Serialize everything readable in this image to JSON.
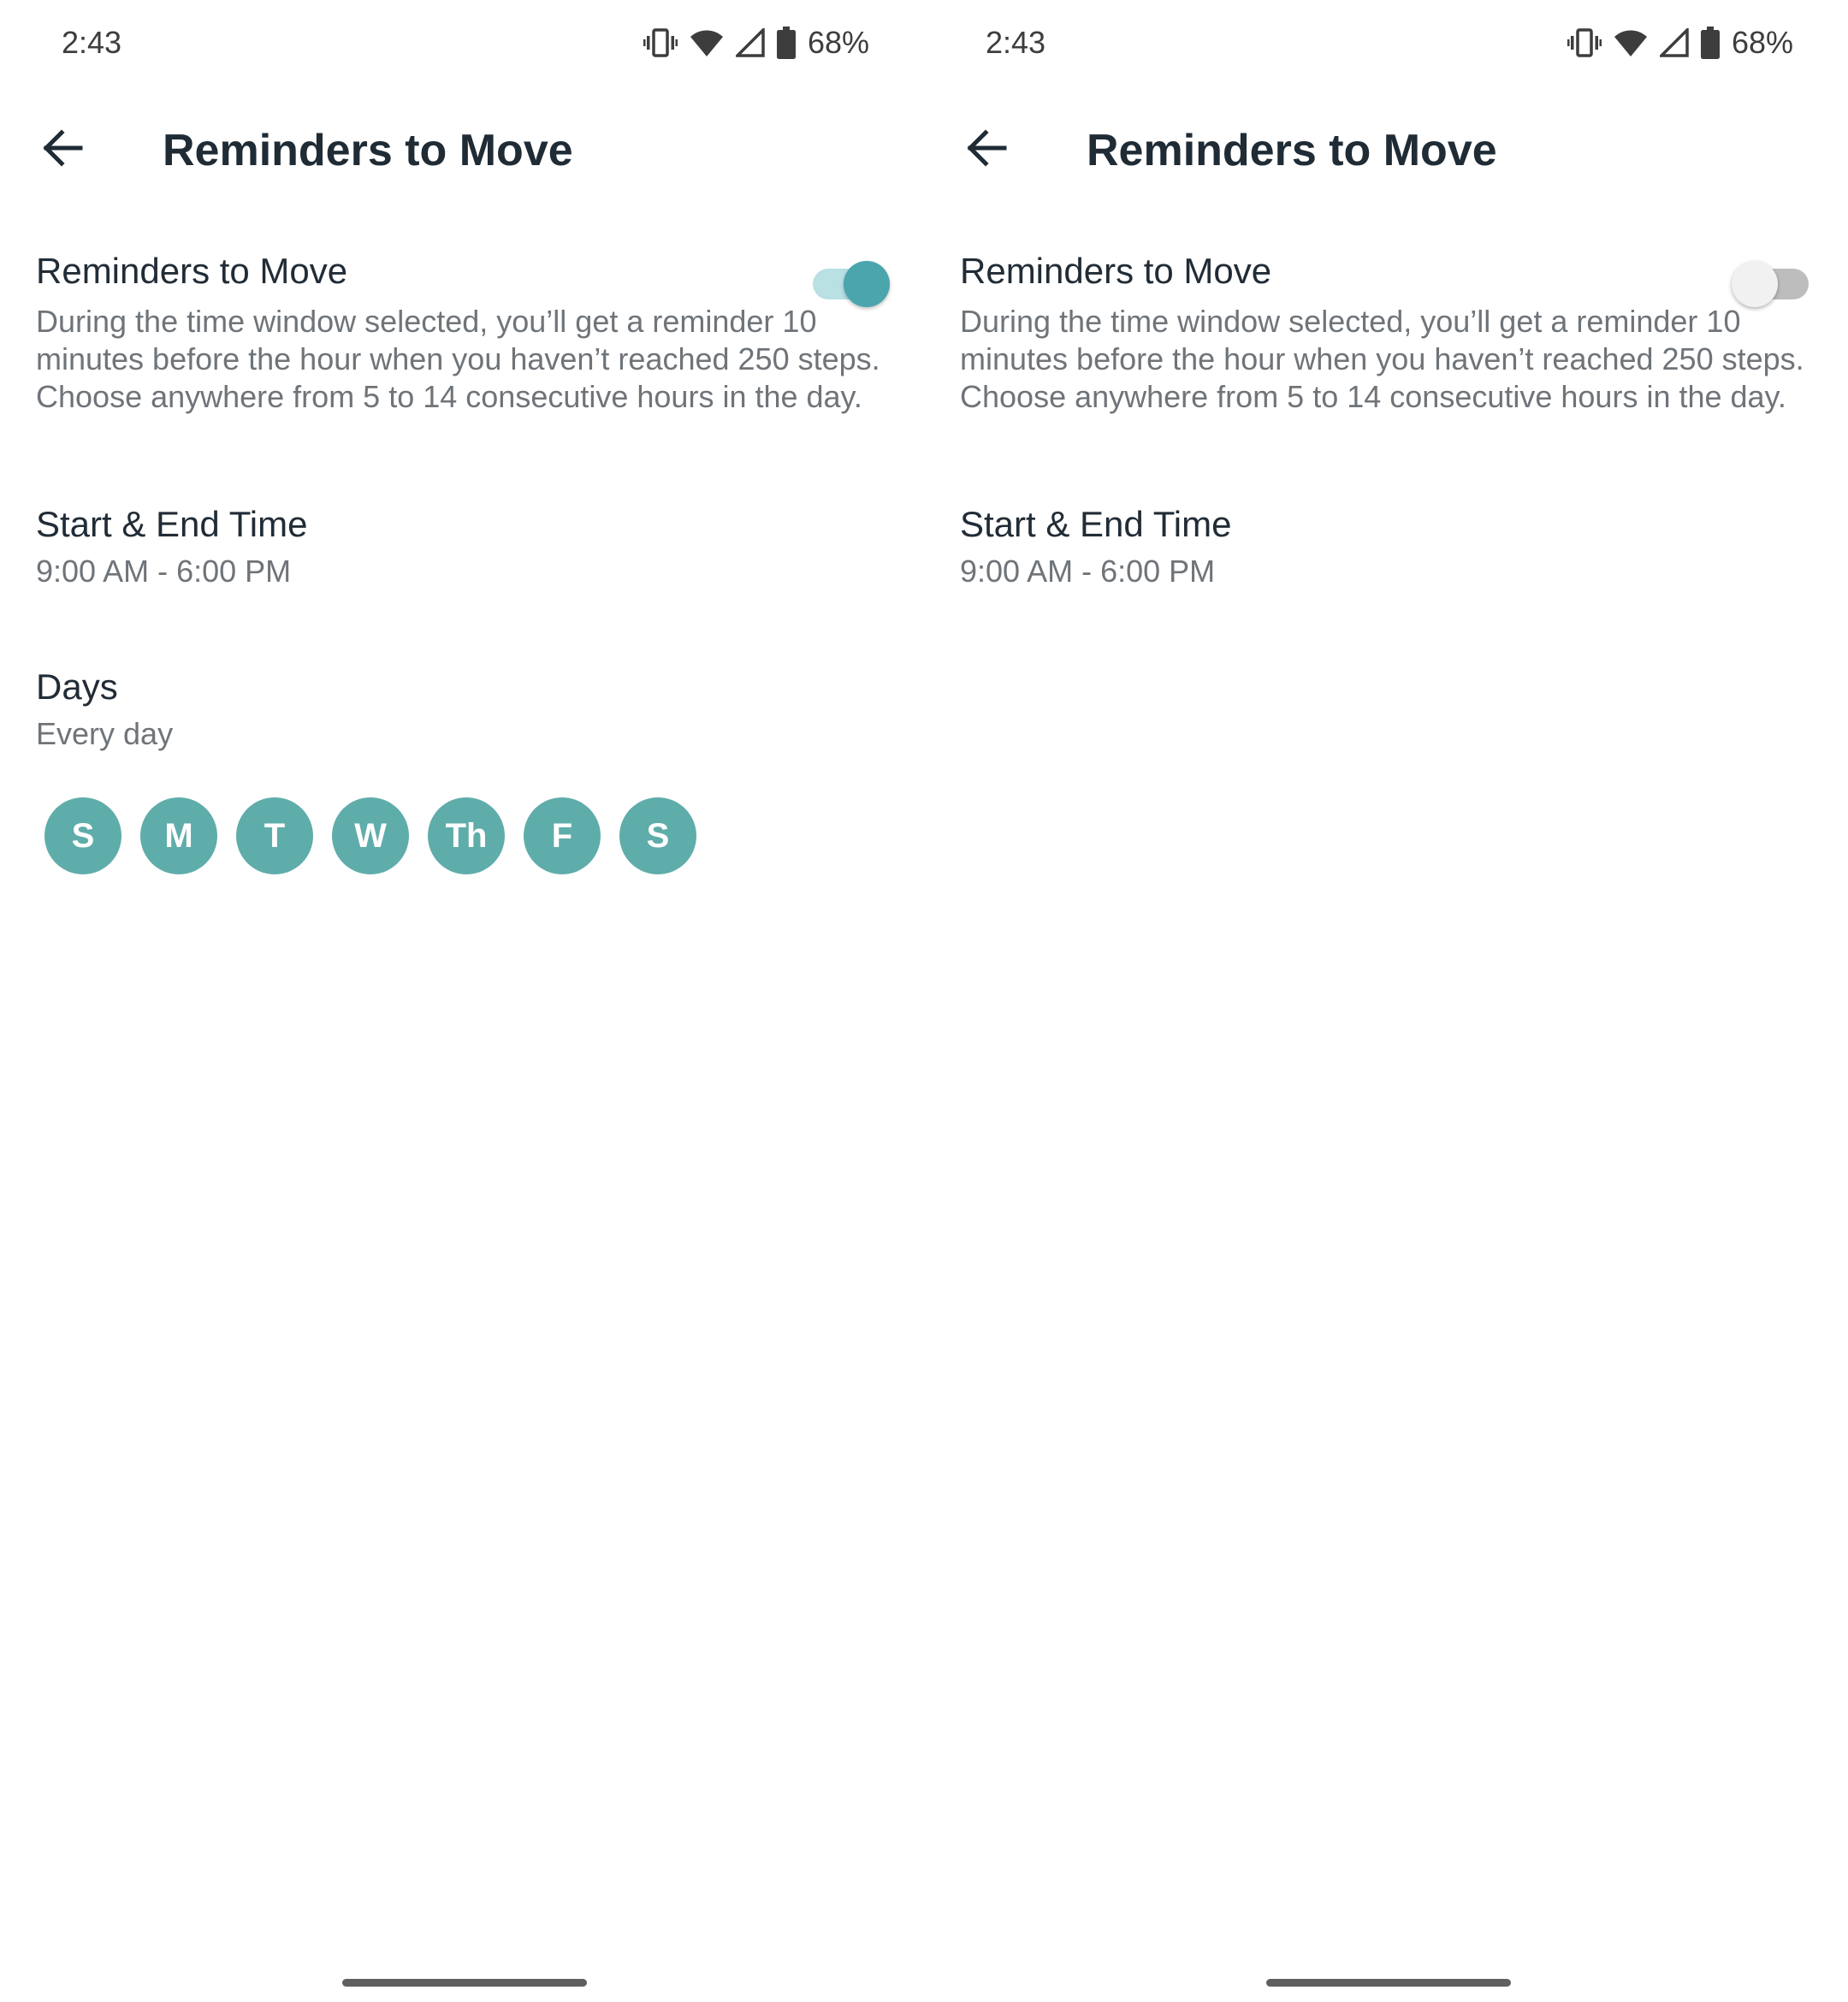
{
  "screens": [
    {
      "status_bar": {
        "time": "2:43",
        "battery_percent": "68%",
        "icons": [
          "vibrate-icon",
          "wifi-icon",
          "signal-icon",
          "battery-icon"
        ]
      },
      "header": {
        "back_icon": "arrow-left-icon",
        "title": "Reminders to Move"
      },
      "reminder_toggle": {
        "label": "Reminders to Move",
        "enabled": true,
        "description": "During the time window selected, you’ll get a reminder 10 minutes before the hour when you haven’t reached 250 steps. Choose anywhere from 5 to 14 consecutive hours in the day."
      },
      "time_window": {
        "label": "Start & End Time",
        "value": "9:00 AM - 6:00 PM"
      },
      "days": {
        "label": "Days",
        "value": "Every day",
        "chips": [
          "S",
          "M",
          "T",
          "W",
          "Th",
          "F",
          "S"
        ]
      }
    },
    {
      "status_bar": {
        "time": "2:43",
        "battery_percent": "68%",
        "icons": [
          "vibrate-icon",
          "wifi-icon",
          "signal-icon",
          "battery-icon"
        ]
      },
      "header": {
        "back_icon": "arrow-left-icon",
        "title": "Reminders to Move"
      },
      "reminder_toggle": {
        "label": "Reminders to Move",
        "enabled": false,
        "description": "During the time window selected, you’ll get a reminder 10 minutes before the hour when you haven’t reached 250 steps. Choose anywhere from 5 to 14 consecutive hours in the day."
      },
      "time_window": {
        "label": "Start & End Time",
        "value": "9:00 AM - 6:00 PM"
      }
    }
  ],
  "colors": {
    "accent": "#4aa5ad",
    "day_chip": "#5fadaa",
    "toggle_track_on": "#b9e0e3",
    "toggle_track_off": "#bdbdbd",
    "title_text": "#1f2b35",
    "secondary_text": "#6f7479"
  }
}
